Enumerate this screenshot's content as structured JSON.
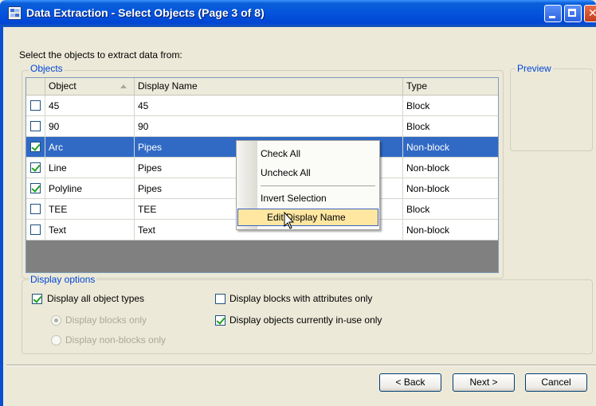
{
  "window": {
    "title": "Data Extraction - Select Objects (Page 3 of 8)"
  },
  "instruction": "Select the objects to extract data from:",
  "objects_group": {
    "label": "Objects",
    "columns": {
      "object": "Object",
      "display_name": "Display Name",
      "type": "Type"
    },
    "rows": [
      {
        "checked": false,
        "object": "45",
        "display_name": "45",
        "type": "Block",
        "selected": false
      },
      {
        "checked": false,
        "object": "90",
        "display_name": "90",
        "type": "Block",
        "selected": false
      },
      {
        "checked": true,
        "object": "Arc",
        "display_name": "Pipes",
        "type": "Non-block",
        "selected": true
      },
      {
        "checked": true,
        "object": "Line",
        "display_name": "Pipes",
        "type": "Non-block",
        "selected": false
      },
      {
        "checked": true,
        "object": "Polyline",
        "display_name": "Pipes",
        "type": "Non-block",
        "selected": false
      },
      {
        "checked": false,
        "object": "TEE",
        "display_name": "TEE",
        "type": "Block",
        "selected": false
      },
      {
        "checked": false,
        "object": "Text",
        "display_name": "Text",
        "type": "Non-block",
        "selected": false
      }
    ]
  },
  "preview_group": {
    "label": "Preview"
  },
  "context_menu": {
    "items": [
      "Check All",
      "Uncheck All",
      "Invert Selection",
      "Edit Display Name"
    ],
    "highlighted_index": 3
  },
  "display_options": {
    "label": "Display options",
    "display_all_object_types": {
      "label": "Display all object types",
      "checked": true
    },
    "display_blocks_only": {
      "label": "Display blocks only",
      "selected": true,
      "enabled": false
    },
    "display_non_blocks_only": {
      "label": "Display non-blocks only",
      "selected": false,
      "enabled": false
    },
    "blocks_with_attributes_only": {
      "label": "Display blocks with attributes only",
      "checked": false
    },
    "objects_in_use_only": {
      "label": "Display objects currently in-use only",
      "checked": true
    }
  },
  "buttons": {
    "back": "< Back",
    "next": "Next >",
    "cancel": "Cancel"
  },
  "colors": {
    "selection": "#316ac5",
    "group_label": "#0046d5",
    "menu_hover": "#ffe7a2",
    "title_bar": "#0453dd"
  }
}
